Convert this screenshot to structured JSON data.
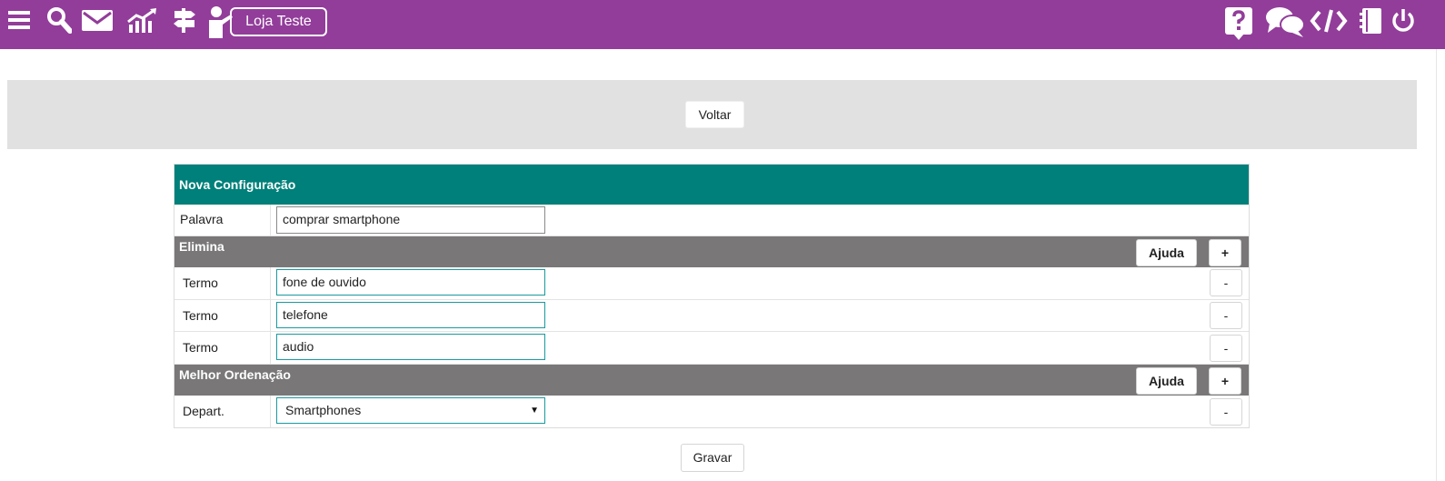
{
  "topbar": {
    "store_label": "Loja Teste",
    "background": "#923d9a",
    "left_icons": [
      "menu-icon",
      "search-icon",
      "mail-icon",
      "growth-chart-icon",
      "signpost-icon",
      "presenter-icon"
    ],
    "right_icons": [
      "help-icon",
      "chat-icon",
      "code-icon",
      "notebook-icon",
      "power-icon"
    ]
  },
  "toolbar": {
    "back_label": "Voltar"
  },
  "form": {
    "header": "Nova Configuração",
    "header_color": "#00807a",
    "word_label": "Palavra",
    "word_value": "comprar smartphone",
    "eliminate": {
      "title": "Elimina",
      "help_label": "Ajuda",
      "add_label": "+",
      "rows": [
        {
          "label": "Termo",
          "value": "fone de ouvido",
          "remove_label": "-"
        },
        {
          "label": "Termo",
          "value": "telefone",
          "remove_label": "-"
        },
        {
          "label": "Termo",
          "value": "audio",
          "remove_label": "-"
        }
      ]
    },
    "ordering": {
      "title": "Melhor Ordenação",
      "help_label": "Ajuda",
      "add_label": "+",
      "rows": [
        {
          "label": "Depart.",
          "value": "Smartphones",
          "remove_label": "-"
        }
      ]
    },
    "save_label": "Gravar"
  }
}
